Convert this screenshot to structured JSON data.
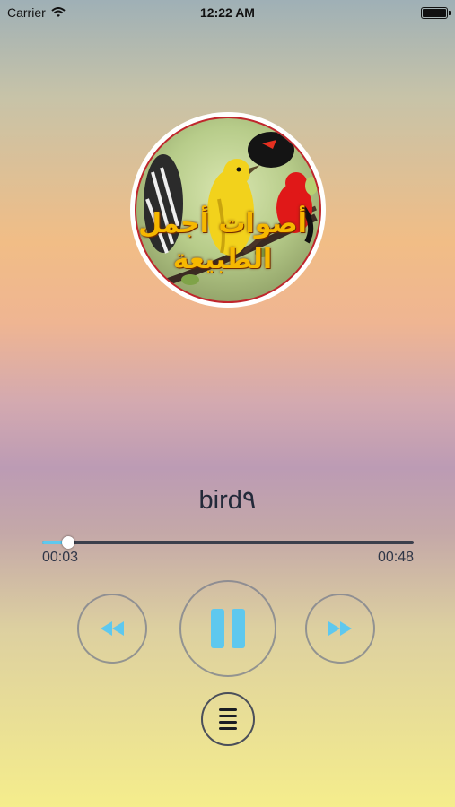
{
  "status_bar": {
    "carrier": "Carrier",
    "time": "12:22 AM",
    "wifi_icon": "wifi-icon",
    "battery_icon": "battery-icon"
  },
  "artwork": {
    "line1": "أصوات أجمل",
    "line2": "الطبيعة",
    "border_color": "#c0262c",
    "text_color": "#f6b800"
  },
  "track": {
    "title": "bird٩"
  },
  "progress": {
    "elapsed": "00:03",
    "total": "00:48",
    "fraction": 0.07,
    "accent_color": "#5ec8ee"
  },
  "controls": {
    "previous": "rewind-icon",
    "play_pause": "pause-icon",
    "next": "fast-forward-icon",
    "playlist": "list-icon"
  }
}
